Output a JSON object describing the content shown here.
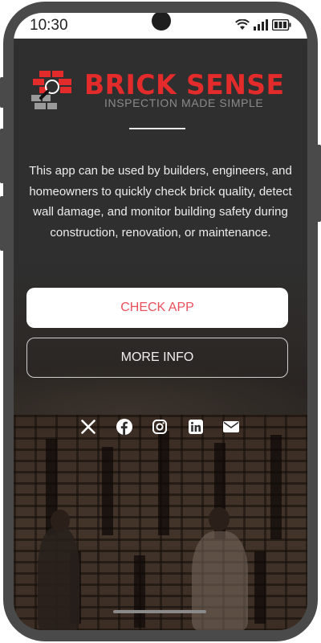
{
  "status_bar": {
    "time": "10:30",
    "icons": [
      "wifi-icon",
      "signal-icon",
      "battery-icon"
    ]
  },
  "brand": {
    "title": "BRICK SENSE",
    "tagline": "INSPECTION MADE SIMPLE",
    "logo_icon": "brick-magnifier-icon",
    "accent_color": "#e32b2b"
  },
  "description": "This app can be used by builders, engineers, and homeowners to quickly check brick quality, detect wall damage, and monitor building safety during construction, renovation, or maintenance.",
  "buttons": {
    "primary_label": "CHECK APP",
    "secondary_label": "MORE INFO"
  },
  "social_links": [
    {
      "name": "x",
      "icon": "x-icon"
    },
    {
      "name": "facebook",
      "icon": "facebook-icon"
    },
    {
      "name": "instagram",
      "icon": "instagram-icon"
    },
    {
      "name": "linkedin",
      "icon": "linkedin-icon"
    },
    {
      "name": "email",
      "icon": "mail-icon"
    }
  ],
  "colors": {
    "screen_background": "#2f2f2f",
    "primary_button_text": "#e8505b",
    "frame": "#4a4a4a"
  }
}
